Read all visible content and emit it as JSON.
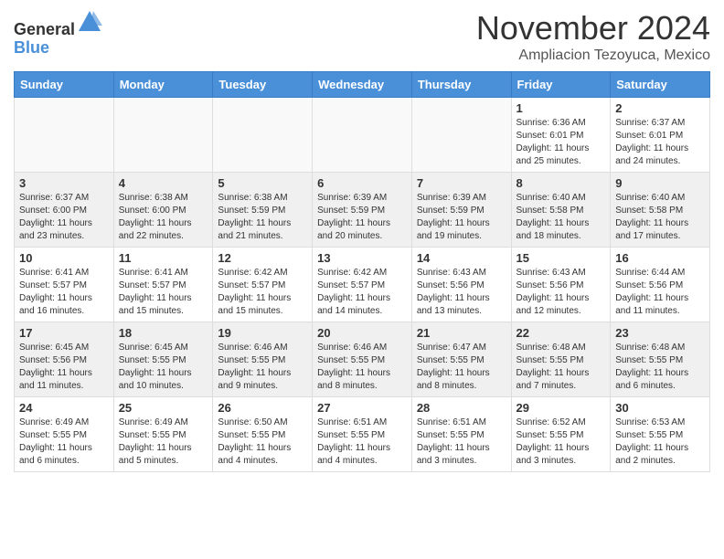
{
  "header": {
    "logo_general": "General",
    "logo_blue": "Blue",
    "month_title": "November 2024",
    "subtitle": "Ampliacion Tezoyuca, Mexico"
  },
  "days_of_week": [
    "Sunday",
    "Monday",
    "Tuesday",
    "Wednesday",
    "Thursday",
    "Friday",
    "Saturday"
  ],
  "weeks": [
    [
      {
        "day": "",
        "info": ""
      },
      {
        "day": "",
        "info": ""
      },
      {
        "day": "",
        "info": ""
      },
      {
        "day": "",
        "info": ""
      },
      {
        "day": "",
        "info": ""
      },
      {
        "day": "1",
        "info": "Sunrise: 6:36 AM\nSunset: 6:01 PM\nDaylight: 11 hours and 25 minutes."
      },
      {
        "day": "2",
        "info": "Sunrise: 6:37 AM\nSunset: 6:01 PM\nDaylight: 11 hours and 24 minutes."
      }
    ],
    [
      {
        "day": "3",
        "info": "Sunrise: 6:37 AM\nSunset: 6:00 PM\nDaylight: 11 hours and 23 minutes."
      },
      {
        "day": "4",
        "info": "Sunrise: 6:38 AM\nSunset: 6:00 PM\nDaylight: 11 hours and 22 minutes."
      },
      {
        "day": "5",
        "info": "Sunrise: 6:38 AM\nSunset: 5:59 PM\nDaylight: 11 hours and 21 minutes."
      },
      {
        "day": "6",
        "info": "Sunrise: 6:39 AM\nSunset: 5:59 PM\nDaylight: 11 hours and 20 minutes."
      },
      {
        "day": "7",
        "info": "Sunrise: 6:39 AM\nSunset: 5:59 PM\nDaylight: 11 hours and 19 minutes."
      },
      {
        "day": "8",
        "info": "Sunrise: 6:40 AM\nSunset: 5:58 PM\nDaylight: 11 hours and 18 minutes."
      },
      {
        "day": "9",
        "info": "Sunrise: 6:40 AM\nSunset: 5:58 PM\nDaylight: 11 hours and 17 minutes."
      }
    ],
    [
      {
        "day": "10",
        "info": "Sunrise: 6:41 AM\nSunset: 5:57 PM\nDaylight: 11 hours and 16 minutes."
      },
      {
        "day": "11",
        "info": "Sunrise: 6:41 AM\nSunset: 5:57 PM\nDaylight: 11 hours and 15 minutes."
      },
      {
        "day": "12",
        "info": "Sunrise: 6:42 AM\nSunset: 5:57 PM\nDaylight: 11 hours and 15 minutes."
      },
      {
        "day": "13",
        "info": "Sunrise: 6:42 AM\nSunset: 5:57 PM\nDaylight: 11 hours and 14 minutes."
      },
      {
        "day": "14",
        "info": "Sunrise: 6:43 AM\nSunset: 5:56 PM\nDaylight: 11 hours and 13 minutes."
      },
      {
        "day": "15",
        "info": "Sunrise: 6:43 AM\nSunset: 5:56 PM\nDaylight: 11 hours and 12 minutes."
      },
      {
        "day": "16",
        "info": "Sunrise: 6:44 AM\nSunset: 5:56 PM\nDaylight: 11 hours and 11 minutes."
      }
    ],
    [
      {
        "day": "17",
        "info": "Sunrise: 6:45 AM\nSunset: 5:56 PM\nDaylight: 11 hours and 11 minutes."
      },
      {
        "day": "18",
        "info": "Sunrise: 6:45 AM\nSunset: 5:55 PM\nDaylight: 11 hours and 10 minutes."
      },
      {
        "day": "19",
        "info": "Sunrise: 6:46 AM\nSunset: 5:55 PM\nDaylight: 11 hours and 9 minutes."
      },
      {
        "day": "20",
        "info": "Sunrise: 6:46 AM\nSunset: 5:55 PM\nDaylight: 11 hours and 8 minutes."
      },
      {
        "day": "21",
        "info": "Sunrise: 6:47 AM\nSunset: 5:55 PM\nDaylight: 11 hours and 8 minutes."
      },
      {
        "day": "22",
        "info": "Sunrise: 6:48 AM\nSunset: 5:55 PM\nDaylight: 11 hours and 7 minutes."
      },
      {
        "day": "23",
        "info": "Sunrise: 6:48 AM\nSunset: 5:55 PM\nDaylight: 11 hours and 6 minutes."
      }
    ],
    [
      {
        "day": "24",
        "info": "Sunrise: 6:49 AM\nSunset: 5:55 PM\nDaylight: 11 hours and 6 minutes."
      },
      {
        "day": "25",
        "info": "Sunrise: 6:49 AM\nSunset: 5:55 PM\nDaylight: 11 hours and 5 minutes."
      },
      {
        "day": "26",
        "info": "Sunrise: 6:50 AM\nSunset: 5:55 PM\nDaylight: 11 hours and 4 minutes."
      },
      {
        "day": "27",
        "info": "Sunrise: 6:51 AM\nSunset: 5:55 PM\nDaylight: 11 hours and 4 minutes."
      },
      {
        "day": "28",
        "info": "Sunrise: 6:51 AM\nSunset: 5:55 PM\nDaylight: 11 hours and 3 minutes."
      },
      {
        "day": "29",
        "info": "Sunrise: 6:52 AM\nSunset: 5:55 PM\nDaylight: 11 hours and 3 minutes."
      },
      {
        "day": "30",
        "info": "Sunrise: 6:53 AM\nSunset: 5:55 PM\nDaylight: 11 hours and 2 minutes."
      }
    ]
  ]
}
